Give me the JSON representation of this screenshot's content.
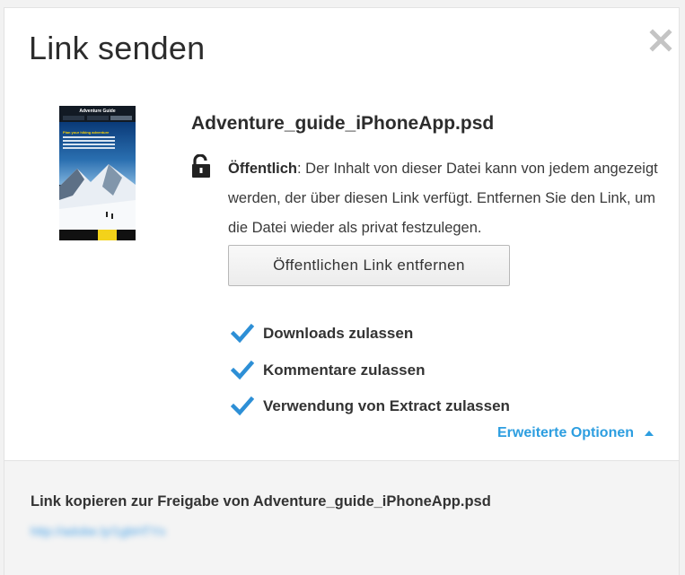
{
  "dialog": {
    "title": "Link senden",
    "close_icon": "close-icon"
  },
  "file": {
    "name": "Adventure_guide_iPhoneApp.psd",
    "thumbnail": {
      "app_title": "Adventure Guide",
      "headline": "Plan your hiking adventure"
    }
  },
  "access": {
    "lock_icon": "unlock-icon",
    "status_label": "Öffentlich",
    "description": ": Der Inhalt von dieser Datei kann von jedem angezeigt werden, der über diesen Link verfügt. Entfernen Sie den Link, um die Datei wieder als privat festzulegen.",
    "remove_button": "Öffentlichen Link entfernen"
  },
  "options": [
    {
      "label": "Downloads zulassen",
      "checked": true
    },
    {
      "label": "Kommentare zulassen",
      "checked": true
    },
    {
      "label": "Verwendung von Extract zulassen",
      "checked": true
    }
  ],
  "advanced": {
    "label": "Erweiterte Optionen",
    "expanded": true
  },
  "footer": {
    "copy_label": "Link kopieren zur Freigabe von Adventure_guide_iPhoneApp.psd",
    "link_url": "http://adobe.ly/1gbHTYx"
  },
  "colors": {
    "accent": "#2d9ee0",
    "check": "#2d8fd6",
    "text": "#2c2c2c",
    "footer_bg": "#f4f4f4"
  }
}
